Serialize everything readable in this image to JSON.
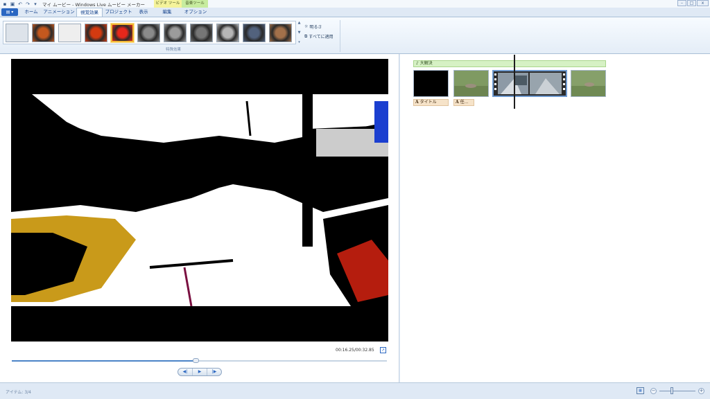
{
  "window": {
    "title": "マイ ムービー - Windows Live ムービー メーカー",
    "context_tabs": {
      "video_tools": "ビデオ ツール",
      "music_tools": "音楽ツール"
    },
    "controls": {
      "minimize": "–",
      "maximize": "□",
      "close": "x"
    }
  },
  "quick_access": {
    "icons": [
      "save-icon",
      "undo-icon",
      "redo-icon",
      "customize-icon"
    ]
  },
  "tabs": [
    {
      "label": "ホーム"
    },
    {
      "label": "アニメーション"
    },
    {
      "label": "視覚効果",
      "active": true
    },
    {
      "label": "プロジェクト"
    },
    {
      "label": "表示"
    },
    {
      "label": "編集"
    },
    {
      "label": "オプション"
    }
  ],
  "ribbon": {
    "group_label": "特殊効果",
    "selected_effect_index": 4,
    "brightness_label": "明るさ",
    "apply_all_label": "すべてに適用",
    "effect_colors": [
      "#dde3ea",
      "#c4581e",
      "#eeeeee",
      "#d33a10",
      "#e6271b",
      "#8a8a8a",
      "#9b9b9b",
      "#767676",
      "#b6b6b6",
      "#52627d",
      "#a2704a"
    ]
  },
  "preview": {
    "timecode": "00:16.25/00:32.85",
    "progress": 0.49,
    "transport": {
      "prev": "◀|",
      "play": "▶",
      "next": "|▶"
    }
  },
  "storyboard": {
    "music_label": "♪ 大解決",
    "captions": [
      {
        "icon_text": "A",
        "text": "タイトル"
      },
      {
        "icon_text": "A",
        "text": "任…"
      }
    ]
  },
  "status": {
    "items": "アイテム: 3/4",
    "zoom_minus": "−",
    "zoom_plus": "+",
    "zoom_level": 0.35
  }
}
